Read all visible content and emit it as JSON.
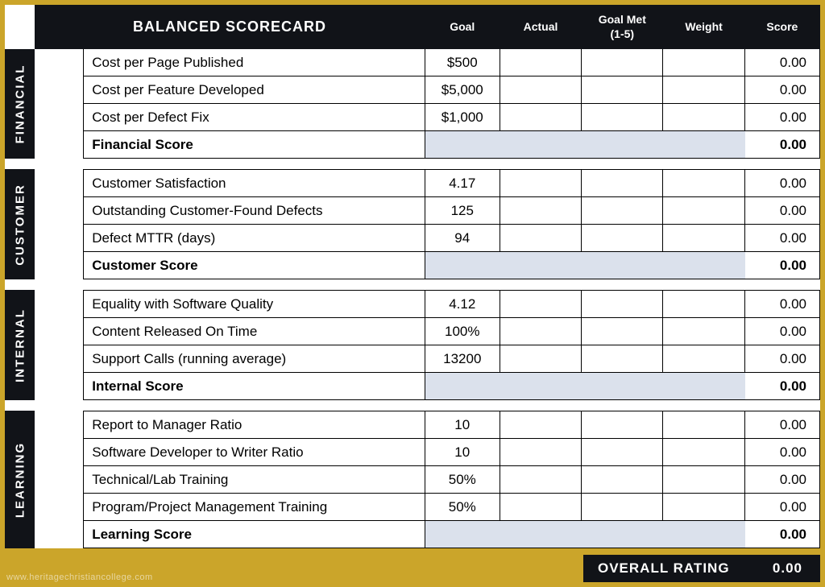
{
  "header": {
    "title": "BALANCED SCORECARD",
    "columns": {
      "goal": "Goal",
      "actual": "Actual",
      "met": "Goal Met\n(1-5)",
      "weight": "Weight",
      "score": "Score"
    }
  },
  "sections": [
    {
      "label": "FINANCIAL",
      "rows": [
        {
          "metric": "Cost per Page Published",
          "goal": "$500",
          "actual": "",
          "met": "",
          "weight": "",
          "score": "0.00"
        },
        {
          "metric": "Cost per Feature Developed",
          "goal": "$5,000",
          "actual": "",
          "met": "",
          "weight": "",
          "score": "0.00"
        },
        {
          "metric": "Cost per Defect Fix",
          "goal": "$1,000",
          "actual": "",
          "met": "",
          "weight": "",
          "score": "0.00"
        }
      ],
      "subtotal": {
        "label": "Financial Score",
        "score": "0.00"
      }
    },
    {
      "label": "CUSTOMER",
      "rows": [
        {
          "metric": "Customer Satisfaction",
          "goal": "4.17",
          "actual": "",
          "met": "",
          "weight": "",
          "score": "0.00"
        },
        {
          "metric": "Outstanding Customer-Found Defects",
          "goal": "125",
          "actual": "",
          "met": "",
          "weight": "",
          "score": "0.00"
        },
        {
          "metric": "Defect MTTR (days)",
          "goal": "94",
          "actual": "",
          "met": "",
          "weight": "",
          "score": "0.00"
        }
      ],
      "subtotal": {
        "label": "Customer Score",
        "score": "0.00"
      }
    },
    {
      "label": "INTERNAL",
      "rows": [
        {
          "metric": "Equality with Software Quality",
          "goal": "4.12",
          "actual": "",
          "met": "",
          "weight": "",
          "score": "0.00"
        },
        {
          "metric": "Content Released On Time",
          "goal": "100%",
          "actual": "",
          "met": "",
          "weight": "",
          "score": "0.00"
        },
        {
          "metric": "Support Calls (running average)",
          "goal": "13200",
          "actual": "",
          "met": "",
          "weight": "",
          "score": "0.00"
        }
      ],
      "subtotal": {
        "label": "Internal Score",
        "score": "0.00"
      }
    },
    {
      "label": "LEARNING",
      "rows": [
        {
          "metric": "Report to Manager Ratio",
          "goal": "10",
          "actual": "",
          "met": "",
          "weight": "",
          "score": "0.00"
        },
        {
          "metric": "Software Developer to Writer Ratio",
          "goal": "10",
          "actual": "",
          "met": "",
          "weight": "",
          "score": "0.00"
        },
        {
          "metric": "Technical/Lab Training",
          "goal": "50%",
          "actual": "",
          "met": "",
          "weight": "",
          "score": "0.00"
        },
        {
          "metric": "Program/Project Management Training",
          "goal": "50%",
          "actual": "",
          "met": "",
          "weight": "",
          "score": "0.00"
        }
      ],
      "subtotal": {
        "label": "Learning Score",
        "score": "0.00"
      }
    }
  ],
  "overall": {
    "label": "OVERALL RATING",
    "score": "0.00"
  },
  "watermark": "www.heritagechristiancollege.com"
}
